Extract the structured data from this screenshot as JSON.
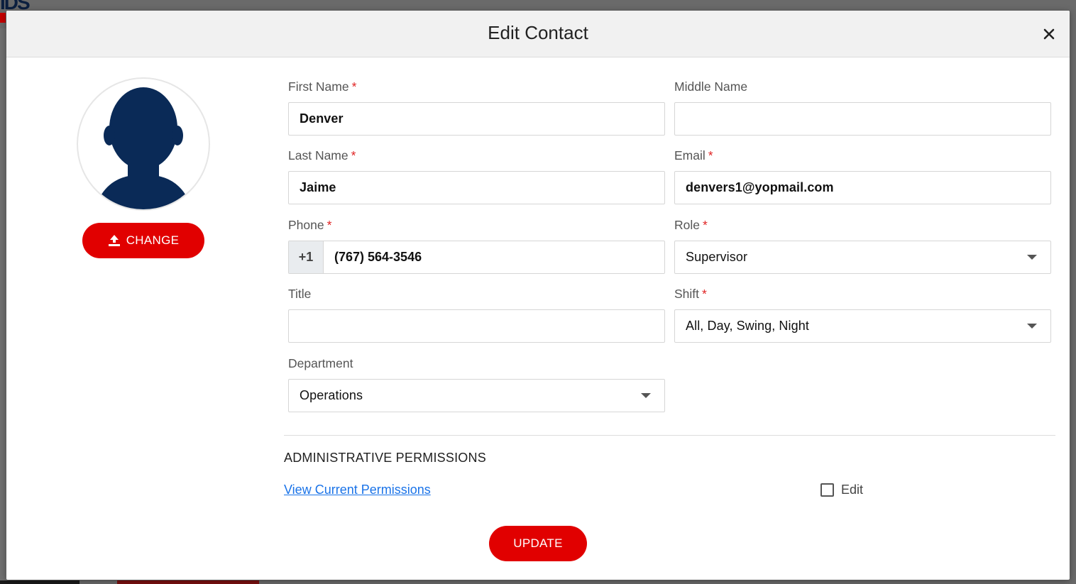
{
  "background": {
    "logo_text": "IDS"
  },
  "modal": {
    "title": "Edit Contact"
  },
  "avatar": {
    "change_label": "CHANGE"
  },
  "form": {
    "first_name": {
      "label": "First Name",
      "required": "*",
      "value": "Denver"
    },
    "middle_name": {
      "label": "Middle Name",
      "value": ""
    },
    "last_name": {
      "label": "Last Name",
      "required": "*",
      "value": "Jaime"
    },
    "email": {
      "label": "Email",
      "required": "*",
      "value": "denvers1@yopmail.com"
    },
    "phone": {
      "label": "Phone",
      "required": "*",
      "prefix": "+1",
      "value": "(767) 564-3546"
    },
    "role": {
      "label": "Role",
      "required": "*",
      "value": "Supervisor"
    },
    "title": {
      "label": "Title",
      "value": ""
    },
    "shift": {
      "label": "Shift",
      "required": "*",
      "value": "All, Day, Swing, Night"
    },
    "department": {
      "label": "Department",
      "value": "Operations"
    }
  },
  "permissions": {
    "heading": "ADMINISTRATIVE PERMISSIONS",
    "link": "View Current Permissions",
    "edit_label": "Edit",
    "edit_checked": false
  },
  "actions": {
    "update_label": "UPDATE"
  },
  "colors": {
    "accent": "#e10000",
    "avatar": "#0a2a57",
    "link": "#1a73e8",
    "required": "#e02424"
  }
}
